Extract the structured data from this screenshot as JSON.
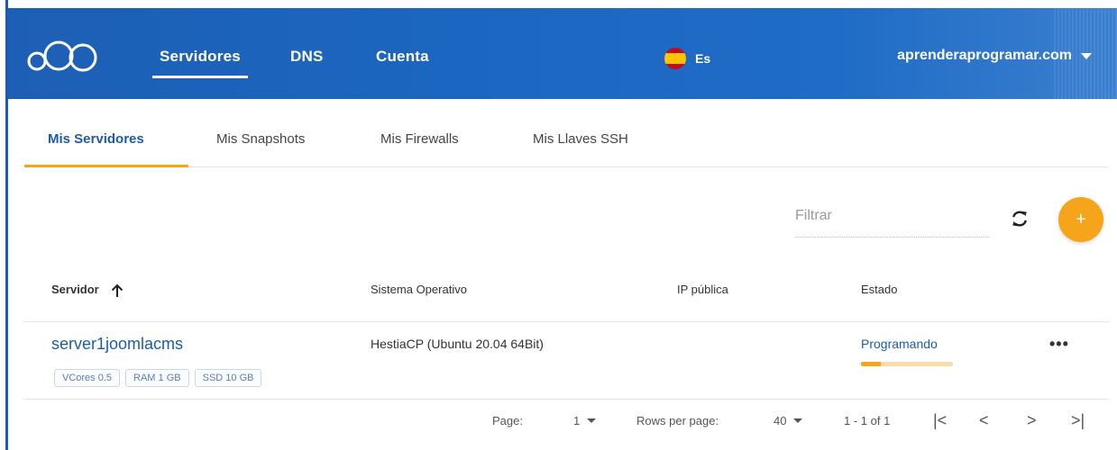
{
  "header": {
    "nav": [
      {
        "label": "Servidores",
        "active": true
      },
      {
        "label": "DNS",
        "active": false
      },
      {
        "label": "Cuenta",
        "active": false
      }
    ],
    "language": "Es",
    "account": "aprenderaprogramar.com"
  },
  "tabs": [
    {
      "label": "Mis Servidores",
      "active": true
    },
    {
      "label": "Mis Snapshots",
      "active": false
    },
    {
      "label": "Mis Firewalls",
      "active": false
    },
    {
      "label": "Mis Llaves SSH",
      "active": false
    }
  ],
  "toolbar": {
    "filter_placeholder": "Filtrar",
    "add_label": "+"
  },
  "table": {
    "columns": [
      "Servidor",
      "Sistema Operativo",
      "IP pública",
      "Estado"
    ],
    "rows": [
      {
        "name": "server1joomlacms",
        "chips": [
          "VCores 0.5",
          "RAM 1 GB",
          "SSD 10 GB"
        ],
        "os": "HestiaCP (Ubuntu 20.04 64Bit)",
        "ip": "",
        "status": "Programando",
        "progress": 0.22,
        "menu": "•••"
      }
    ]
  },
  "pagination": {
    "page_label": "Page:",
    "page_value": "1",
    "rows_label": "Rows per page:",
    "rows_value": "40",
    "range": "1 - 1 of 1",
    "first": "|<",
    "prev": "<",
    "next": ">",
    "last": ">|"
  },
  "colors": {
    "primary": "#1c5bb0",
    "accent": "#f6a51a"
  }
}
